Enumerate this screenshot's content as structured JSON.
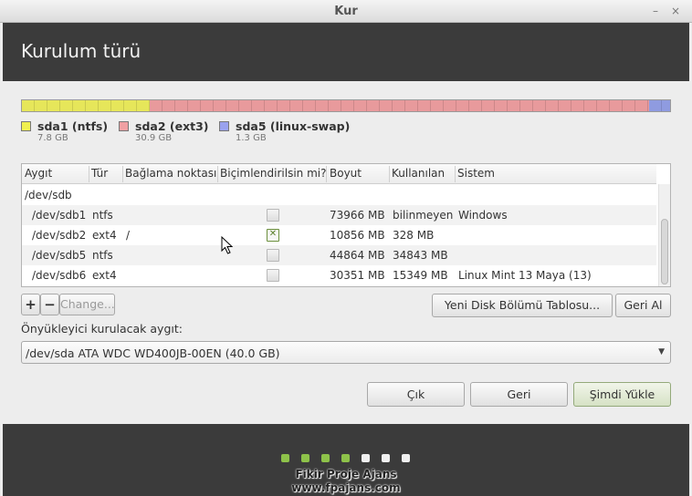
{
  "window": {
    "title": "Kur",
    "minimize_glyph": "–",
    "close_glyph": "×"
  },
  "header": {
    "title": "Kurulum türü"
  },
  "partition_bar": {
    "segments": [
      {
        "name": "sda1",
        "fraction": 0.197,
        "color": "#e6e65a"
      },
      {
        "name": "sda2",
        "fraction": 0.771,
        "color": "#e89a9c"
      },
      {
        "name": "sda5",
        "fraction": 0.032,
        "color": "#8f9be0"
      }
    ]
  },
  "legend": [
    {
      "label": "sda1 (ntfs)",
      "size": "7.8 GB",
      "color": "#f0f050"
    },
    {
      "label": "sda2 (ext3)",
      "size": "30.9 GB",
      "color": "#f0a0a3"
    },
    {
      "label": "sda5 (linux-swap)",
      "size": "1.3 GB",
      "color": "#9aa2ef"
    }
  ],
  "table": {
    "columns": [
      "Aygıt",
      "Tür",
      "Bağlama noktası",
      "Biçimlendirilsin mi?",
      "Boyut",
      "Kullanılan",
      "Sistem"
    ],
    "group": "/dev/sdb",
    "rows": [
      {
        "device": "/dev/sdb1",
        "type": "ntfs",
        "mount": "",
        "format": false,
        "size": "73966 MB",
        "used": "bilinmeyen",
        "system": "Windows"
      },
      {
        "device": "/dev/sdb2",
        "type": "ext4",
        "mount": "/",
        "format": true,
        "size": "10856 MB",
        "used": "328 MB",
        "system": ""
      },
      {
        "device": "/dev/sdb5",
        "type": "ntfs",
        "mount": "",
        "format": false,
        "size": "44864 MB",
        "used": "34843 MB",
        "system": ""
      },
      {
        "device": "/dev/sdb6",
        "type": "ext4",
        "mount": "",
        "format": false,
        "size": "30351 MB",
        "used": "15349 MB",
        "system": "Linux Mint 13 Maya (13)"
      }
    ]
  },
  "toolbar": {
    "add": "+",
    "remove": "−",
    "change": "Change...",
    "new_table": "Yeni Disk Bölümü Tablosu...",
    "revert": "Geri Al"
  },
  "bootloader": {
    "label": "Önyükleyici kurulacak aygıt:",
    "value": "/dev/sda   ATA WDC WD400JB-00EN (40.0 GB)"
  },
  "actions": {
    "quit": "Çık",
    "back": "Geri",
    "install": "Şimdi Yükle"
  },
  "progress": {
    "total_steps": 7,
    "completed_steps": 4,
    "done_color": "#8ec24a",
    "todo_color": "#f0f0f0"
  },
  "watermark": {
    "line1": "Fikir Proje Ajans",
    "line2": "www.fpajans.com"
  }
}
